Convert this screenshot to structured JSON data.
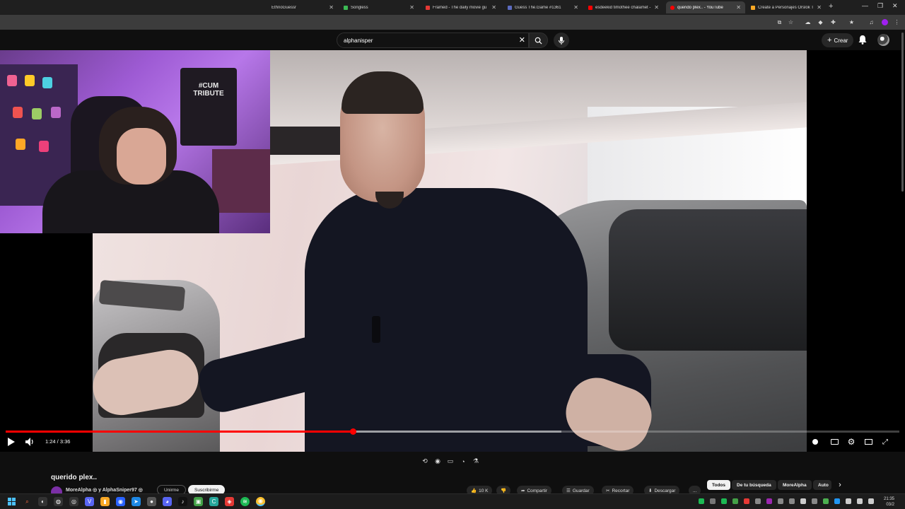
{
  "browser": {
    "tabs": [
      {
        "title": "EthnoGuessr",
        "color": "#2b2b2b",
        "active": false
      },
      {
        "title": "Songless",
        "color": "#3cba54",
        "active": false
      },
      {
        "title": "Framed - The daily movie gu",
        "color": "#e53935",
        "active": false
      },
      {
        "title": "Guess The.Game #1361",
        "color": "#5c6bc0",
        "active": false
      },
      {
        "title": "esdeekid timothee chalamet -",
        "color": "#ff0000",
        "active": false
      },
      {
        "title": "querido plex.. - YouTube",
        "color": "#ff0000",
        "active": true
      },
      {
        "title": "Create a Personajes Orslok Ti",
        "color": "#f9a825",
        "active": false
      }
    ],
    "new_tab_icon": "plus-icon"
  },
  "youtube": {
    "search_value": "alphanisper",
    "create_label": "Crear",
    "video": {
      "current_time": "1:24 / 3:36",
      "progress_fraction": 0.389,
      "buffered_fraction": 0.622
    },
    "title": "querido plex..",
    "channel_text": "MoreAlpha ◎ y AlphaSniper97 ◎",
    "join_label": "Unirme",
    "subscribe_label": "Suscribirme",
    "actions": [
      {
        "label": "10 K",
        "icon": "like-icon"
      },
      {
        "label": "",
        "icon": "dislike-icon"
      },
      {
        "label": "Compartir",
        "icon": "share-icon"
      },
      {
        "label": "Guardar",
        "icon": "save-icon"
      },
      {
        "label": "Recortar",
        "icon": "clip-icon"
      },
      {
        "label": "Descargar",
        "icon": "download-icon"
      },
      {
        "label": "...",
        "icon": "more-icon"
      }
    ],
    "chips": [
      {
        "label": "Todos",
        "selected": true
      },
      {
        "label": "De tu búsqueda",
        "selected": false
      },
      {
        "label": "MoreAlpha",
        "selected": false
      },
      {
        "label": "Auto",
        "selected": false
      }
    ]
  },
  "webcam": {
    "poster_text": "#CUM TRIBUTE"
  },
  "taskbar": {
    "time": "21:35",
    "date": "03/2"
  },
  "colors": {
    "accent_red": "#ff0000",
    "background": "#0f0f0f"
  }
}
